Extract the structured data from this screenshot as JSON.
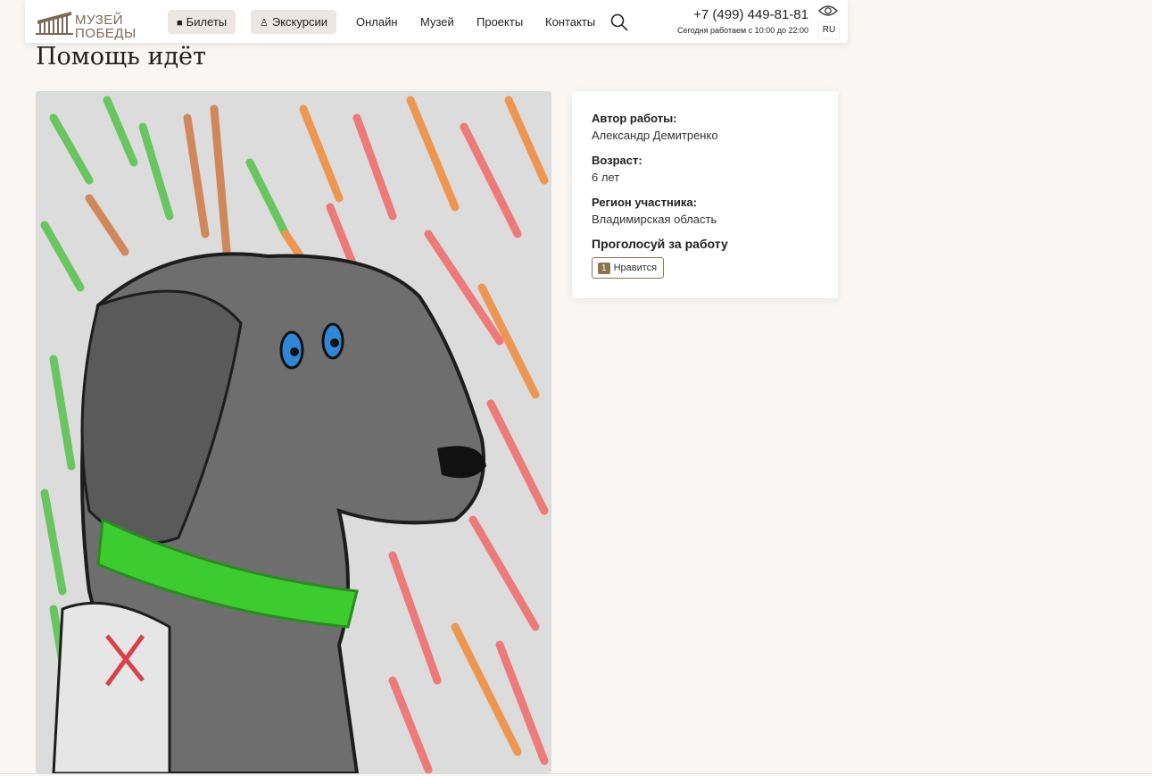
{
  "header": {
    "logo_line1": "МУЗЕЙ",
    "logo_line2": "ПОБЕДЫ",
    "tickets_label": "Билеты",
    "excursions_label": "Экскурсии",
    "nav": [
      "Онлайн",
      "Музей",
      "Проекты",
      "Контакты"
    ],
    "phone": "+7 (499) 449-81-81",
    "hours": "Сегодня работаем с 10:00 до 22:00",
    "lang": "RU"
  },
  "page": {
    "title": "Помощь идёт"
  },
  "info": {
    "author_label": "Автор работы:",
    "author_value": "Александр Демитренко",
    "age_label": "Возраст:",
    "age_value": "6 лет",
    "region_label": "Регион участника:",
    "region_value": "Владимирская область",
    "vote_title": "Проголосуй за работу",
    "like_count": "1",
    "like_label": "Нравится"
  },
  "colors": {
    "accent": "#8a7550",
    "background": "#faf6f3",
    "pill": "#ece7e3"
  }
}
